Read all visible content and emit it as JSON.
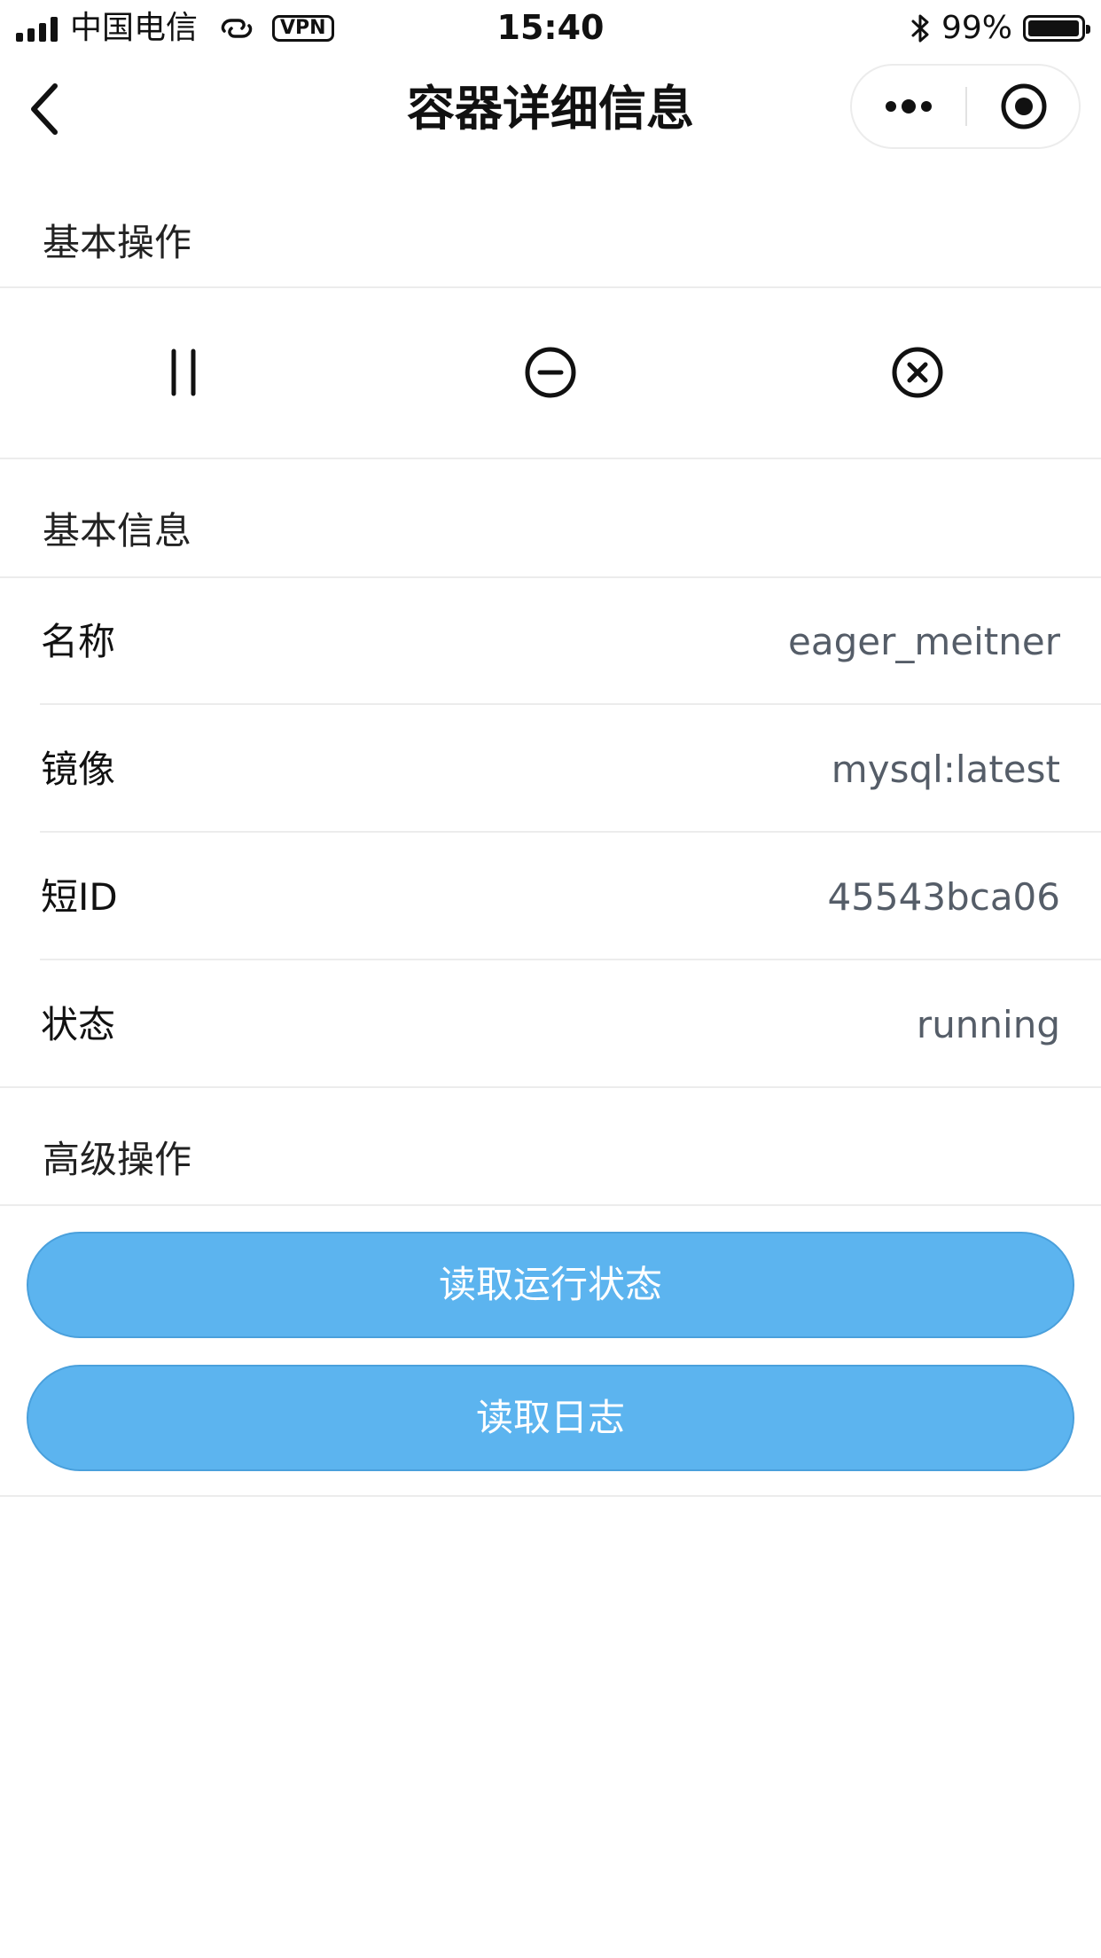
{
  "status_bar": {
    "carrier": "中国电信",
    "vpn": "VPN",
    "time": "15:40",
    "battery_percent": "99%",
    "battery_level": 0.99
  },
  "nav": {
    "title": "容器详细信息",
    "back_icon": "chevron-left-icon",
    "more_icon": "more-dots-icon",
    "close_icon": "target-circle-icon"
  },
  "basic_ops": {
    "header": "基本操作",
    "buttons": [
      {
        "icon": "pause-icon"
      },
      {
        "icon": "minus-circle-icon"
      },
      {
        "icon": "x-circle-icon"
      }
    ]
  },
  "basic_info": {
    "header": "基本信息",
    "rows": [
      {
        "label": "名称",
        "value": "eager_meitner"
      },
      {
        "label": "镜像",
        "value": "mysql:latest"
      },
      {
        "label": "短ID",
        "value": "45543bca06"
      },
      {
        "label": "状态",
        "value": "running"
      }
    ]
  },
  "advanced_ops": {
    "header": "高级操作",
    "buttons": [
      {
        "label": "读取运行状态"
      },
      {
        "label": "读取日志"
      }
    ]
  },
  "colors": {
    "button_bg": "#5cb4ef",
    "value_text": "#555d68",
    "divider": "#ececec"
  }
}
